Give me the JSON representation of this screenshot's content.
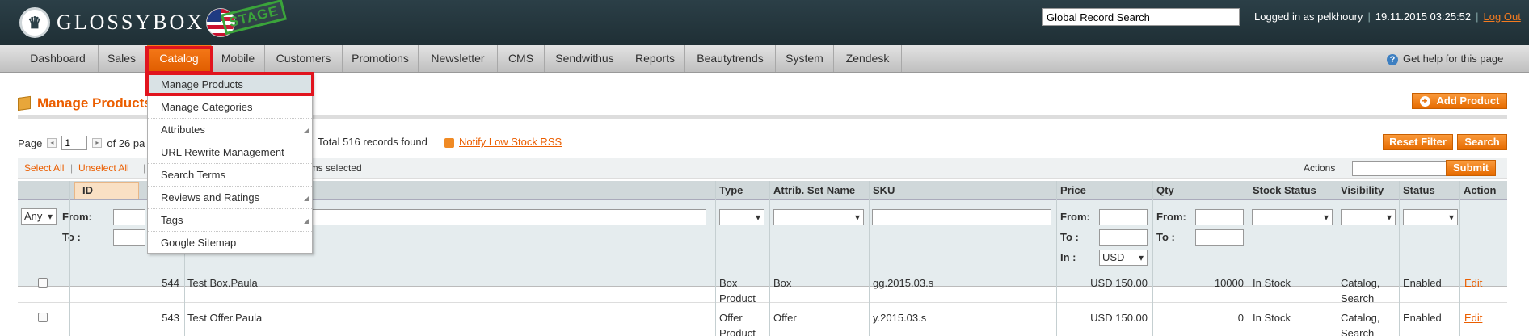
{
  "header": {
    "logo_text": "GLOSSYBOX",
    "stage_label": "STAGE",
    "search_value": "Global Record Search",
    "logged_in": "Logged in as pelkhoury",
    "datetime": "19.11.2015 03:25:52",
    "logout": "Log Out"
  },
  "nav": {
    "items": [
      "Dashboard",
      "Sales",
      "Catalog",
      "Mobile",
      "Customers",
      "Promotions",
      "Newsletter",
      "CMS",
      "Sendwithus",
      "Reports",
      "Beautytrends",
      "System",
      "Zendesk"
    ],
    "active": "Catalog",
    "help": "Get help for this page"
  },
  "catalog_menu": {
    "items": [
      "Manage Products",
      "Manage Categories",
      "Attributes",
      "URL Rewrite Management",
      "Search Terms",
      "Reviews and Ratings",
      "Tags",
      "Google Sitemap"
    ]
  },
  "page": {
    "title": "Manage Products",
    "add_product": "Add Product",
    "reset_filter": "Reset Filter",
    "search": "Search"
  },
  "pager": {
    "label": "Page",
    "page": "1",
    "of_pages": "of 26 pa",
    "records": "Total 516 records found",
    "rss": "Notify Low Stock RSS"
  },
  "massaction": {
    "select_all": "Select All",
    "unselect_all": "Unselect All",
    "s_fragment": "S",
    "items_selected": "ems selected",
    "actions_label": "Actions",
    "submit": "Submit"
  },
  "grid": {
    "columns": {
      "id": "ID",
      "type": "Type",
      "attrib_set": "Attrib. Set Name",
      "sku": "SKU",
      "price": "Price",
      "qty": "Qty",
      "stock_status": "Stock Status",
      "visibility": "Visibility",
      "status": "Status",
      "action": "Action"
    },
    "filters": {
      "any": "Any",
      "from": "From:",
      "to": "To :",
      "in": "In :",
      "currency": "USD"
    },
    "rows": [
      {
        "id": "544",
        "name": "Test Box.Paula",
        "type_l1": "Box",
        "type_l2": "Product",
        "attrib_set": "Box",
        "sku": "gg.2015.03.s",
        "price": "USD 150.00",
        "qty": "10000",
        "stock": "In Stock",
        "vis_l1": "Catalog,",
        "vis_l2": "Search",
        "status": "Enabled",
        "action": "Edit"
      },
      {
        "id": "543",
        "name": "Test Offer.Paula",
        "type_l1": "Offer",
        "type_l2": "Product",
        "attrib_set": "Offer",
        "sku": "y.2015.03.s",
        "price": "USD 150.00",
        "qty": "0",
        "stock": "In Stock",
        "vis_l1": "Catalog,",
        "vis_l2": "Search",
        "status": "Enabled",
        "action": "Edit"
      }
    ]
  },
  "colors": {
    "accent": "#eb5e00",
    "header_bg": "#2b3f47",
    "highlight": "#e1141e"
  }
}
